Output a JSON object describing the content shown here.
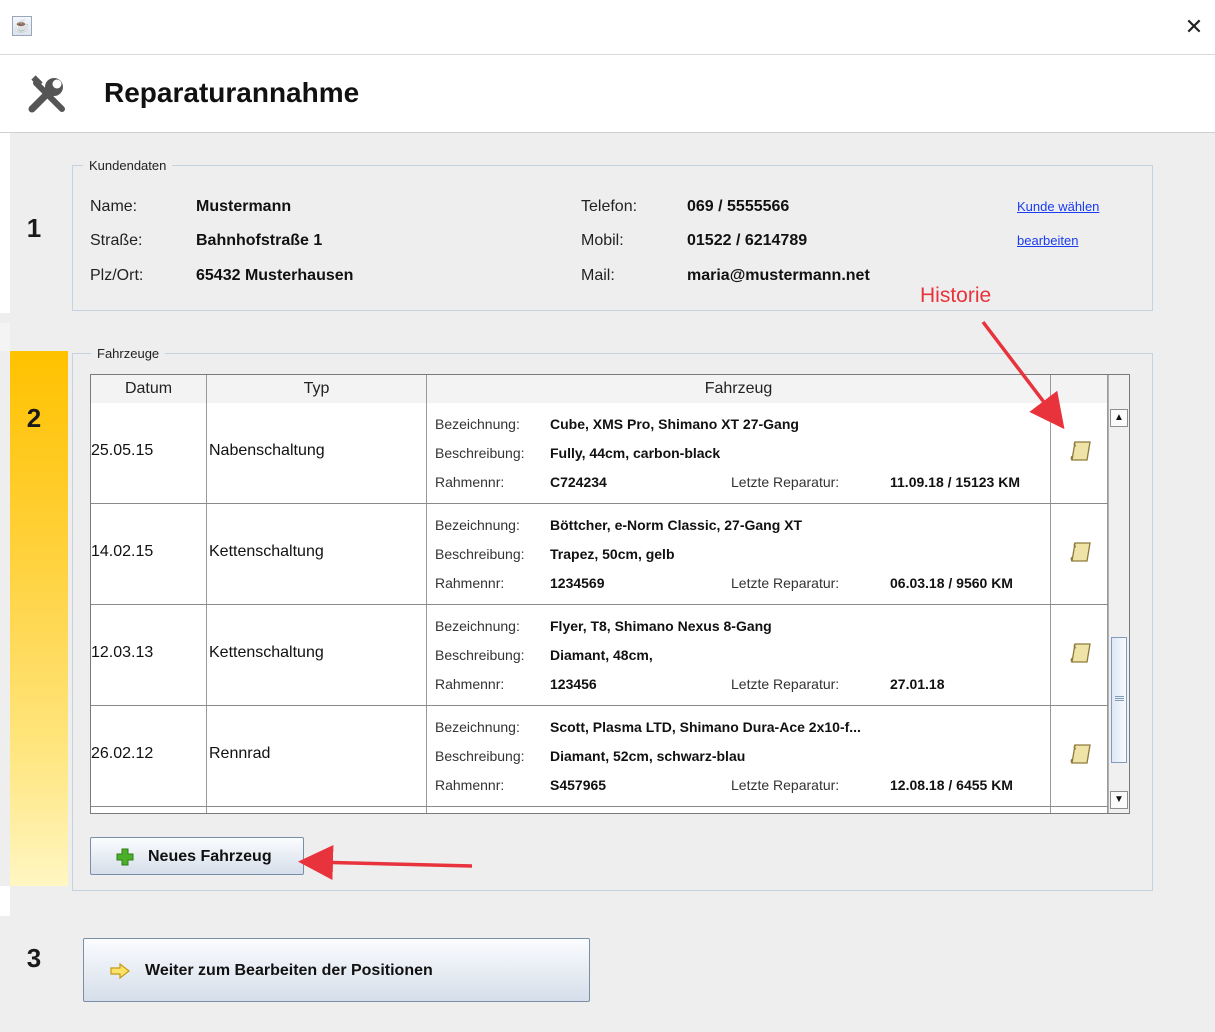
{
  "window": {
    "close_glyph": "✕",
    "app_icon": "java-app-icon"
  },
  "header": {
    "title": "Reparaturannahme",
    "icon": "tools-icon"
  },
  "steps": [
    "1",
    "2",
    "3"
  ],
  "customer": {
    "legend": "Kundendaten",
    "fields": [
      {
        "label": "Name:",
        "value": "Mustermann"
      },
      {
        "label": "Straße:",
        "value": "Bahnhofstraße 1"
      },
      {
        "label": "Plz/Ort:",
        "value": "65432 Musterhausen"
      },
      {
        "label": "Telefon:",
        "value": "069 / 5555566"
      },
      {
        "label": "Mobil:",
        "value": "01522 / 6214789"
      },
      {
        "label": "Mail:",
        "value": "maria@mustermann.net"
      }
    ],
    "links": {
      "choose": "Kunde wählen",
      "edit": "bearbeiten"
    }
  },
  "vehicles": {
    "legend": "Fahrzeuge",
    "columns": [
      "Datum",
      "Typ",
      "Fahrzeug",
      ""
    ],
    "field_labels": {
      "name": "Bezeichnung:",
      "desc": "Beschreibung:",
      "frame": "Rahmennr:",
      "last": "Letzte Reparatur:"
    },
    "rows": [
      {
        "date": "25.05.15",
        "type": "Nabenschaltung",
        "name": "Cube, XMS Pro, Shimano XT 27-Gang",
        "desc": "Fully, 44cm, carbon-black",
        "frame": "C724234",
        "last": "11.09.18 / 15123 KM"
      },
      {
        "date": "14.02.15",
        "type": "Kettenschaltung",
        "name": "Böttcher, e-Norm Classic, 27-Gang XT",
        "desc": "Trapez, 50cm, gelb",
        "frame": "1234569",
        "last": "06.03.18 / 9560 KM"
      },
      {
        "date": "12.03.13",
        "type": "Kettenschaltung",
        "name": "Flyer, T8, Shimano Nexus 8-Gang",
        "desc": "Diamant, 48cm,",
        "frame": "123456",
        "last": "27.01.18"
      },
      {
        "date": "26.02.12",
        "type": "Rennrad",
        "name": "Scott, Plasma LTD, Shimano Dura-Ace 2x10-f...",
        "desc": "Diamant, 52cm, schwarz-blau",
        "frame": "S457965",
        "last": "12.08.18 / 6455 KM"
      }
    ],
    "new_button": "Neues Fahrzeug"
  },
  "next_button": "Weiter zum Bearbeiten der Positionen",
  "annotation": {
    "history": "Historie",
    "color": "#e8333c"
  },
  "colors": {
    "accent": "#ffc200",
    "link": "#1a3cf0",
    "background": "#eeeeee"
  }
}
